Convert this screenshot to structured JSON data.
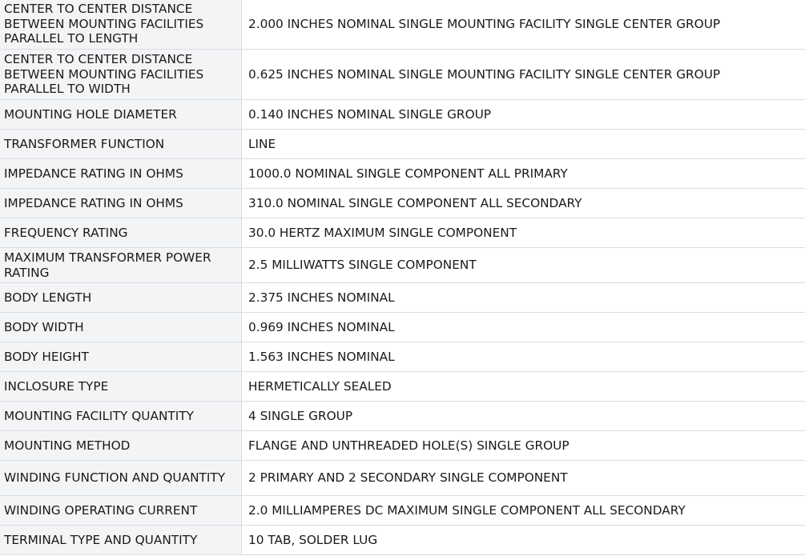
{
  "rows": [
    {
      "name": "CENTER TO CENTER DISTANCE BETWEEN MOUNTING FACILITIES PARALLEL TO LENGTH",
      "value": "2.000 INCHES NOMINAL SINGLE MOUNTING FACILITY SINGLE CENTER GROUP"
    },
    {
      "name": "CENTER TO CENTER DISTANCE BETWEEN MOUNTING FACILITIES PARALLEL TO WIDTH",
      "value": "0.625 INCHES NOMINAL SINGLE MOUNTING FACILITY SINGLE CENTER GROUP"
    },
    {
      "name": "MOUNTING HOLE DIAMETER",
      "value": "0.140 INCHES NOMINAL SINGLE GROUP"
    },
    {
      "name": "TRANSFORMER FUNCTION",
      "value": "LINE"
    },
    {
      "name": "IMPEDANCE RATING IN OHMS",
      "value": "1000.0 NOMINAL SINGLE COMPONENT ALL PRIMARY"
    },
    {
      "name": "IMPEDANCE RATING IN OHMS",
      "value": "310.0 NOMINAL SINGLE COMPONENT ALL SECONDARY"
    },
    {
      "name": "FREQUENCY RATING",
      "value": "30.0 HERTZ MAXIMUM SINGLE COMPONENT"
    },
    {
      "name": "MAXIMUM TRANSFORMER POWER RATING",
      "value": "2.5 MILLIWATTS SINGLE COMPONENT"
    },
    {
      "name": "BODY LENGTH",
      "value": "2.375 INCHES NOMINAL"
    },
    {
      "name": "BODY WIDTH",
      "value": "0.969 INCHES NOMINAL"
    },
    {
      "name": "BODY HEIGHT",
      "value": "1.563 INCHES NOMINAL"
    },
    {
      "name": "INCLOSURE TYPE",
      "value": "HERMETICALLY SEALED"
    },
    {
      "name": "MOUNTING FACILITY QUANTITY",
      "value": "4 SINGLE GROUP"
    },
    {
      "name": "MOUNTING METHOD",
      "value": "FLANGE AND UNTHREADED HOLE(S) SINGLE GROUP"
    },
    {
      "name": "WINDING FUNCTION AND QUANTITY",
      "value": "2 PRIMARY AND 2 SECONDARY SINGLE COMPONENT"
    },
    {
      "name": "WINDING OPERATING CURRENT",
      "value": "2.0 MILLIAMPERES DC MAXIMUM SINGLE COMPONENT ALL SECONDARY"
    },
    {
      "name": "TERMINAL TYPE AND QUANTITY",
      "value": "10 TAB, SOLDER LUG"
    }
  ]
}
